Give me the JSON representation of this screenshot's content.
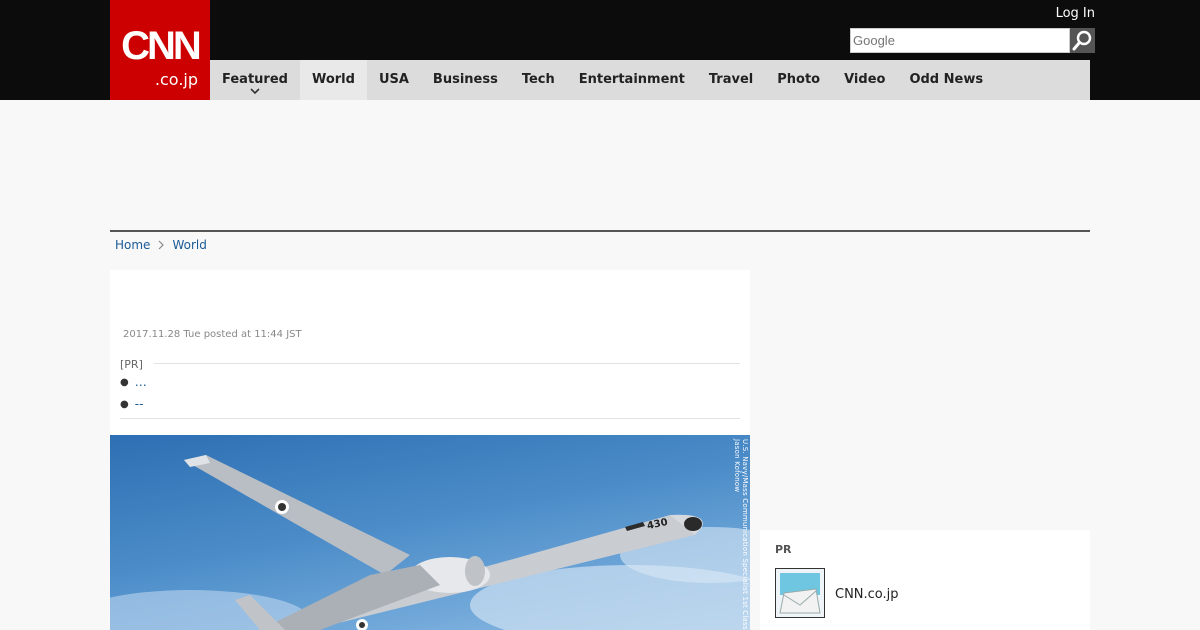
{
  "header": {
    "logo_main": "CNN",
    "logo_sub": ".co.jp",
    "login_label": "Log In",
    "search_placeholder": "Google",
    "colors": {
      "brand": "#cc0000",
      "topbar": "#0c0c0c",
      "nav_bg": "#dcdcdc"
    }
  },
  "nav": {
    "items": [
      {
        "label": "Featured",
        "has_dropdown": true
      },
      {
        "label": "World",
        "active": true
      },
      {
        "label": "USA"
      },
      {
        "label": "Business"
      },
      {
        "label": "Tech"
      },
      {
        "label": "Entertainment"
      },
      {
        "label": "Travel"
      },
      {
        "label": "Photo"
      },
      {
        "label": "Video"
      },
      {
        "label": "Odd News"
      }
    ]
  },
  "breadcrumb": {
    "home": "Home",
    "current": "World"
  },
  "article": {
    "timestamp": "2017.11.28 Tue posted at 11:44 JST",
    "pr_label": "[PR]",
    "pr_links": [
      "…",
      "--"
    ],
    "photo_credit": "U.S. Navy/Mass Communication Specialist 1st Class Jason Kofonow",
    "aircraft_number": "430"
  },
  "sidebar": {
    "pr_label": "PR",
    "items": [
      {
        "label": "CNN.co.jp"
      }
    ]
  }
}
